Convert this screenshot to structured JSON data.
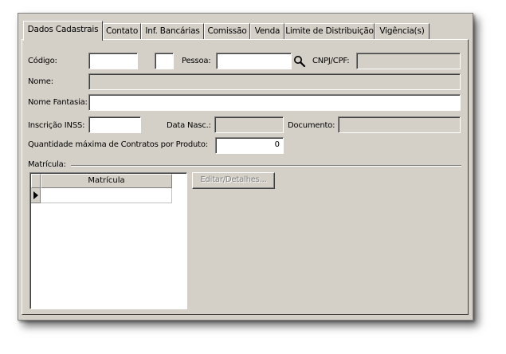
{
  "tabs": [
    {
      "label": "Dados Cadastrais",
      "active": true
    },
    {
      "label": "Contato"
    },
    {
      "label": "Inf. Bancárias"
    },
    {
      "label": "Comissão"
    },
    {
      "label": "Venda"
    },
    {
      "label": "Limite de Distribuição"
    },
    {
      "label": "Vigência(s)"
    }
  ],
  "form": {
    "codigo_label": "Código:",
    "codigo_value": "",
    "codigo_aux_value": "",
    "pessoa_label": "Pessoa:",
    "pessoa_value": "",
    "cnpj_label": "CNPJ/CPF:",
    "cnpj_value": "",
    "nome_label": "Nome:",
    "nome_value": "",
    "nome_fantasia_label": "Nome Fantasia:",
    "nome_fantasia_value": "",
    "inss_label": "Inscrição INSS:",
    "inss_value": "",
    "data_nasc_label": "Data Nasc.:",
    "data_nasc_value": "",
    "documento_label": "Documento:",
    "documento_value": "",
    "qtd_label": "Quantidade máxima de Contratos por Produto:",
    "qtd_value": "0"
  },
  "matricula": {
    "group_label": "Matrícula:",
    "column_header": "Matrícula",
    "rows": [
      ""
    ],
    "edit_button": "Editar/Detalhes..."
  },
  "icons": {
    "search": "magnifier-icon",
    "row_indicator": "row-pointer-icon"
  },
  "colors": {
    "face": "#d4d0c8",
    "field": "#ffffff",
    "disabled_text": "#808080"
  }
}
